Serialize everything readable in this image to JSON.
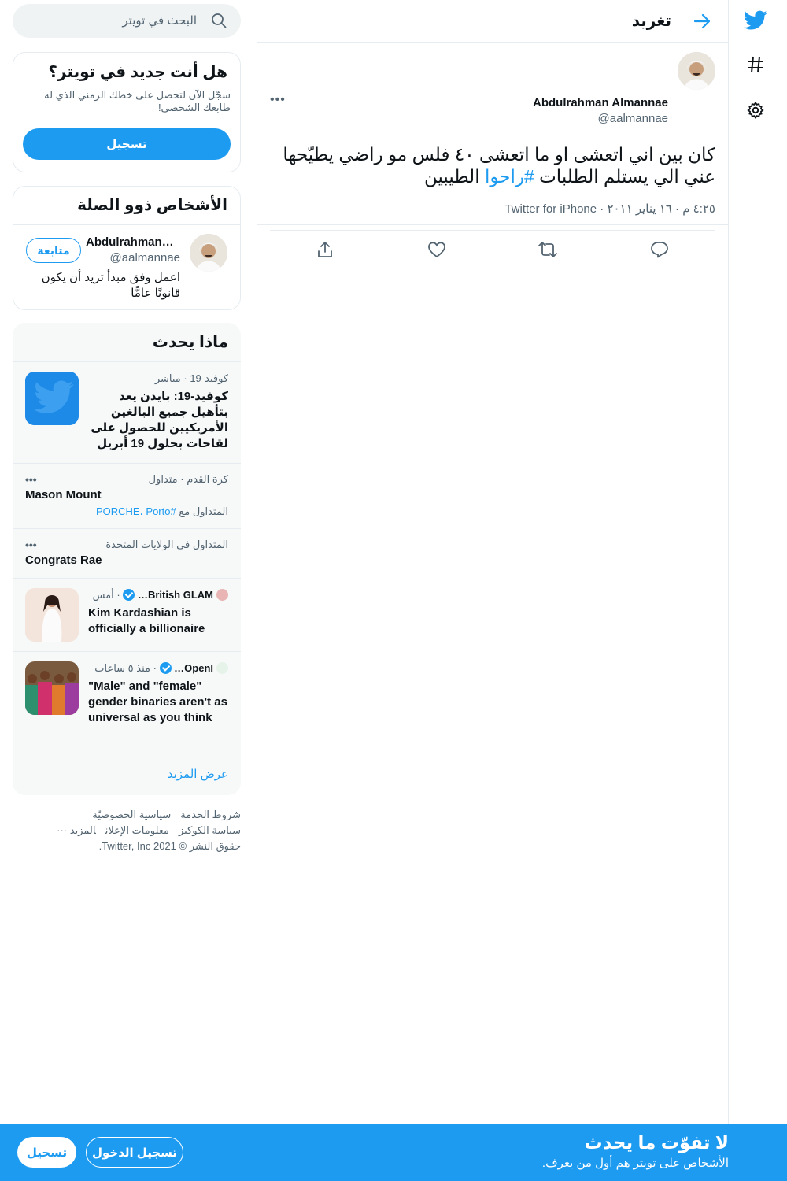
{
  "colors": {
    "accent": "#1d9bf0",
    "text": "#0f1419",
    "secondary": "#536471",
    "border": "#e6ecf0"
  },
  "nav": {
    "icons": [
      "twitter-logo-icon",
      "hashtag-icon",
      "gear-icon"
    ]
  },
  "header": {
    "title": "تغريد"
  },
  "tweet": {
    "author_name": "Abdulrahman Almannae",
    "author_handle": "@aalmannae",
    "text_before": "كان بين اني اتعشى او ما اتعشى ٤٠ فلس مو راضي يطيّحها عني الي يستلم الطلبات ",
    "hashtag": "#راحوا",
    "text_after": " الطيبين",
    "meta": "٤:٢٥ م · ١٦ يناير ٢٠١١ · Twitter for iPhone"
  },
  "search": {
    "placeholder": "البحث في تويتر"
  },
  "new_card": {
    "title": "هل أنت جديد في تويتر؟",
    "body": "سجّل الآن لتحصل على خطك الزمني الذي له طابعك الشخصي!",
    "button": "تسجيل"
  },
  "related": {
    "title": "الأشخاص ذوو الصلة",
    "name": "Abdulrahman…",
    "handle": "@aalmannae",
    "bio": "اعمل وفق مبدأ تريد أن يكون قانونًا عامًّا",
    "follow": "متابعة"
  },
  "trends": {
    "title": "ماذا يحدث",
    "items": [
      {
        "context": "كوفيد-19 · مباشر",
        "title": "كوفيد-19: بايدن يعد بتأهيل جميع البالغين الأمريكيين للحصول على لقاحات بحلول 19 أبريل"
      },
      {
        "context": "كرة القدم · متداول",
        "title": "Mason Mount",
        "related_prefix": "المتداول مع",
        "related": "#PORCHE، Porto"
      },
      {
        "context": "المتداول في الولايات المتحدة",
        "title": "Congrats Rae"
      },
      {
        "source": "British GLAM…",
        "time": "· أمس",
        "title": "Kim Kardashian is officially a billionaire"
      },
      {
        "source": "OpenI…",
        "time": "· منذ ٥ ساعات",
        "title": "\"Male\" and \"female\" gender binaries aren't as universal as you think"
      }
    ],
    "more_glyph": "•••",
    "show_more": "عرض المزيد"
  },
  "footer": {
    "terms": "شروط الخدمة",
    "privacy": "سياسية الخصوصيّة",
    "cookies": "سياسة الكوكيز",
    "ads": "معلومات الإعلان",
    "more": "المزيد ···",
    "copyright": "حقوق النشر © 2021 Twitter, Inc."
  },
  "bottom_bar": {
    "title": "لا تفوّت ما يحدث",
    "subtitle": "الأشخاص على تويتر هم أول من يعرف.",
    "login": "تسجيل الدخول",
    "signup": "تسجيل"
  },
  "tweet_more_glyph": "•••"
}
